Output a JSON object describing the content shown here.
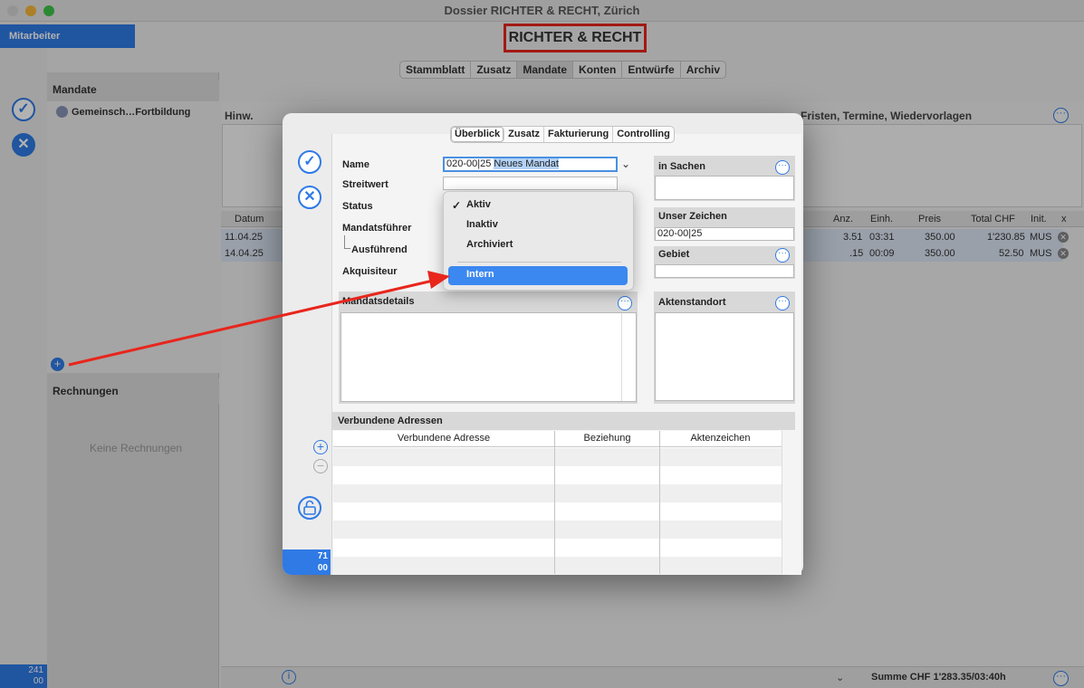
{
  "window": {
    "title": "Dossier RICHTER & RECHT, Zürich"
  },
  "brand": "RICHTER & RECHT",
  "sidebar": {
    "employee_tab": "Mitarbeiter",
    "counter_top": "241",
    "counter_bottom": "00"
  },
  "top_tabs": [
    "Stammblatt",
    "Zusatz",
    "Mandate",
    "Konten",
    "Entwürfe",
    "Archiv"
  ],
  "top_tab_selected": "Mandate",
  "mandate": {
    "header": "Mandate",
    "items": [
      "Gemeinsch…Fortbildung"
    ]
  },
  "rechnungen": {
    "header": "Rechnungen",
    "empty": "Keine Rechnungen"
  },
  "notes": {
    "hinw": "Hinw.",
    "fristen": "Fristen, Termine, Wiedervorlagen"
  },
  "time_table": {
    "columns": [
      "Datum",
      "Anz.",
      "Einh.",
      "Preis",
      "Total CHF",
      "Init.",
      "x"
    ],
    "rows": [
      {
        "date": "11.04.25",
        "anz": "3.51",
        "einh": "03:31",
        "preis": "350.00",
        "total": "1'230.85",
        "init": "MUS"
      },
      {
        "date": "14.04.25",
        "anz": ".15",
        "einh": "00:09",
        "preis": "350.00",
        "total": "52.50",
        "init": "MUS"
      }
    ],
    "summary": "Summe CHF 1'283.35/03:40h"
  },
  "sheet": {
    "tabs": [
      "Überblick",
      "Zusatz",
      "Fakturierung",
      "Controlling"
    ],
    "tab_selected": "Überblick",
    "labels": {
      "name": "Name",
      "streitwert": "Streitwert",
      "status": "Status",
      "mandatsfuehrer": "Mandatsführer",
      "ausfuehrend": "Ausführend",
      "akquisiteur": "Akquisiteur"
    },
    "name_prefix": "020-00|25",
    "name_selected": "Neues Mandat",
    "streitwert_value": "",
    "in_sachen": "in Sachen",
    "unser_zeichen": "Unser Zeichen",
    "unser_zeichen_value": "020-00|25",
    "gebiet": "Gebiet",
    "mandatsdetails": "Mandatsdetails",
    "aktenstandort": "Aktenstandort",
    "verbundene": {
      "title": "Verbundene Adressen",
      "columns": [
        "Verbundene Adresse",
        "Beziehung",
        "Aktenzeichen"
      ]
    },
    "counter_top": "71",
    "counter_bottom": "00"
  },
  "status_menu": {
    "options": [
      "Aktiv",
      "Inaktiv",
      "Archiviert",
      "Intern"
    ],
    "checked": "Aktiv",
    "highlighted": "Intern"
  },
  "colors": {
    "accent": "#2f7ae5",
    "highlight": "#3b88f0",
    "annotation": "#e8261c"
  }
}
